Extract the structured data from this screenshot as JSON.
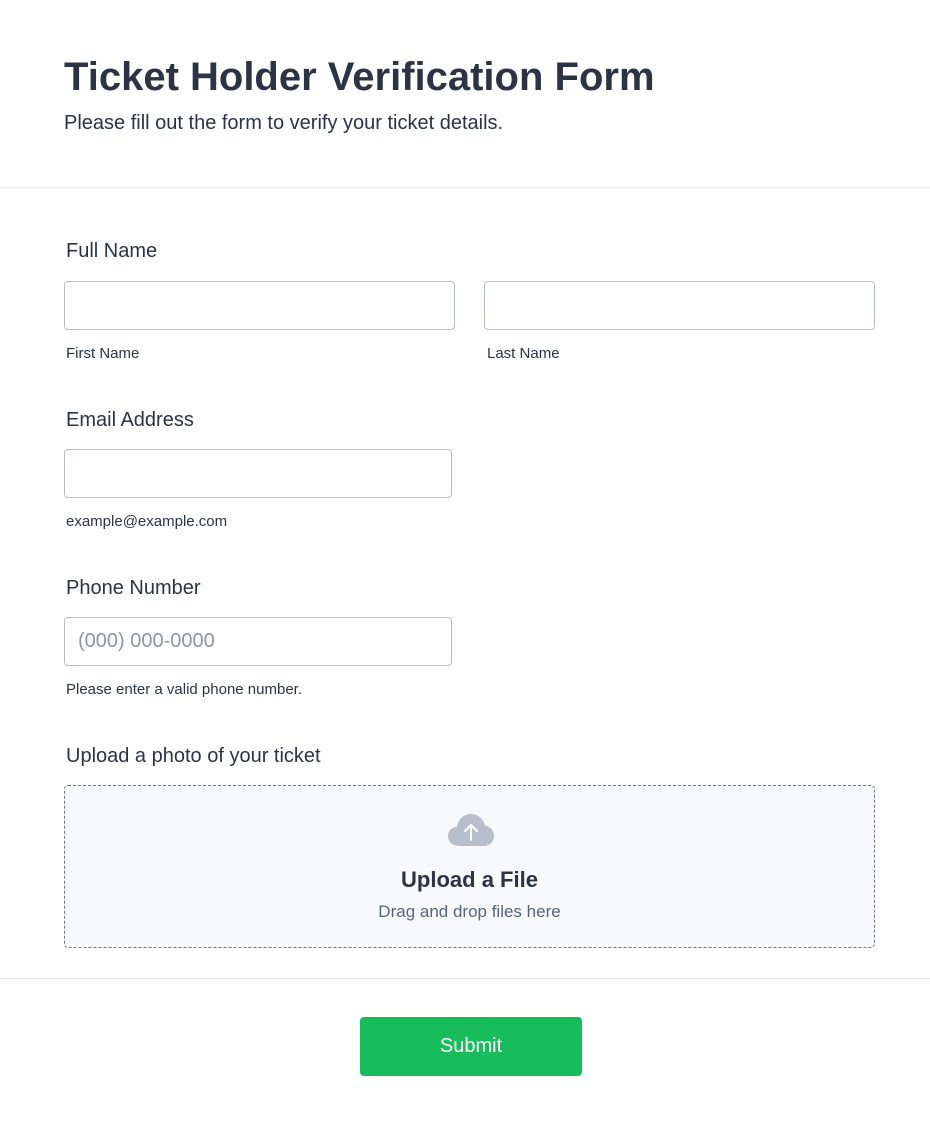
{
  "header": {
    "title": "Ticket Holder Verification Form",
    "subtitle": "Please fill out the form to verify your ticket details."
  },
  "full_name": {
    "label": "Full Name",
    "first_name": {
      "value": "",
      "placeholder": "",
      "sublabel": "First Name"
    },
    "last_name": {
      "value": "",
      "placeholder": "",
      "sublabel": "Last Name"
    }
  },
  "email": {
    "label": "Email Address",
    "value": "",
    "placeholder": "",
    "sublabel": "example@example.com"
  },
  "phone": {
    "label": "Phone Number",
    "value": "",
    "placeholder": "(000) 000-0000",
    "sublabel": "Please enter a valid phone number."
  },
  "upload": {
    "label": "Upload a photo of your ticket",
    "icon": "cloud-upload-icon",
    "title": "Upload a File",
    "hint": "Drag and drop files here"
  },
  "submit": {
    "label": "Submit"
  },
  "colors": {
    "text": "#2c3345",
    "input_border": "#b8bdc9",
    "upload_bg": "#f8f9fc",
    "upload_icon": "#b8bfcc",
    "submit_bg": "#18bd5b",
    "submit_text": "#ffffff"
  }
}
